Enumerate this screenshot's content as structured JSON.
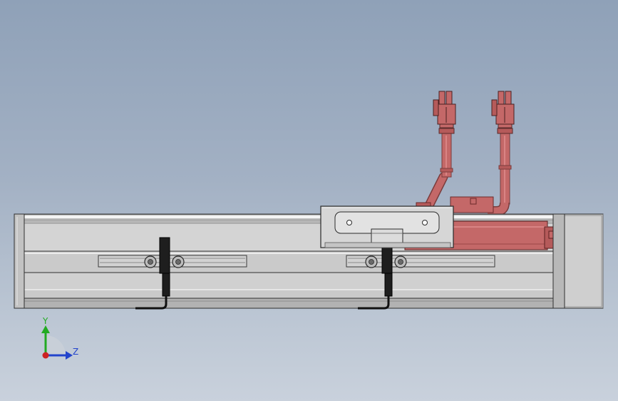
{
  "viewport": {
    "background_top": "#8fa1b8",
    "background_bottom": "#c9d1dc"
  },
  "model": {
    "component": "linear-actuator",
    "colors": {
      "rail": "#dcdcdc",
      "body": "#c8c8c8",
      "carriage": "#d6d6d6",
      "motor": "#c46868",
      "sensor": "#1a1a1a",
      "end_cap": "#c4c4c4"
    }
  },
  "triad": {
    "y_label": "Y",
    "z_label": "Z",
    "y_color": "#22aa22",
    "z_color": "#2244cc",
    "origin_color": "#cc2222"
  }
}
